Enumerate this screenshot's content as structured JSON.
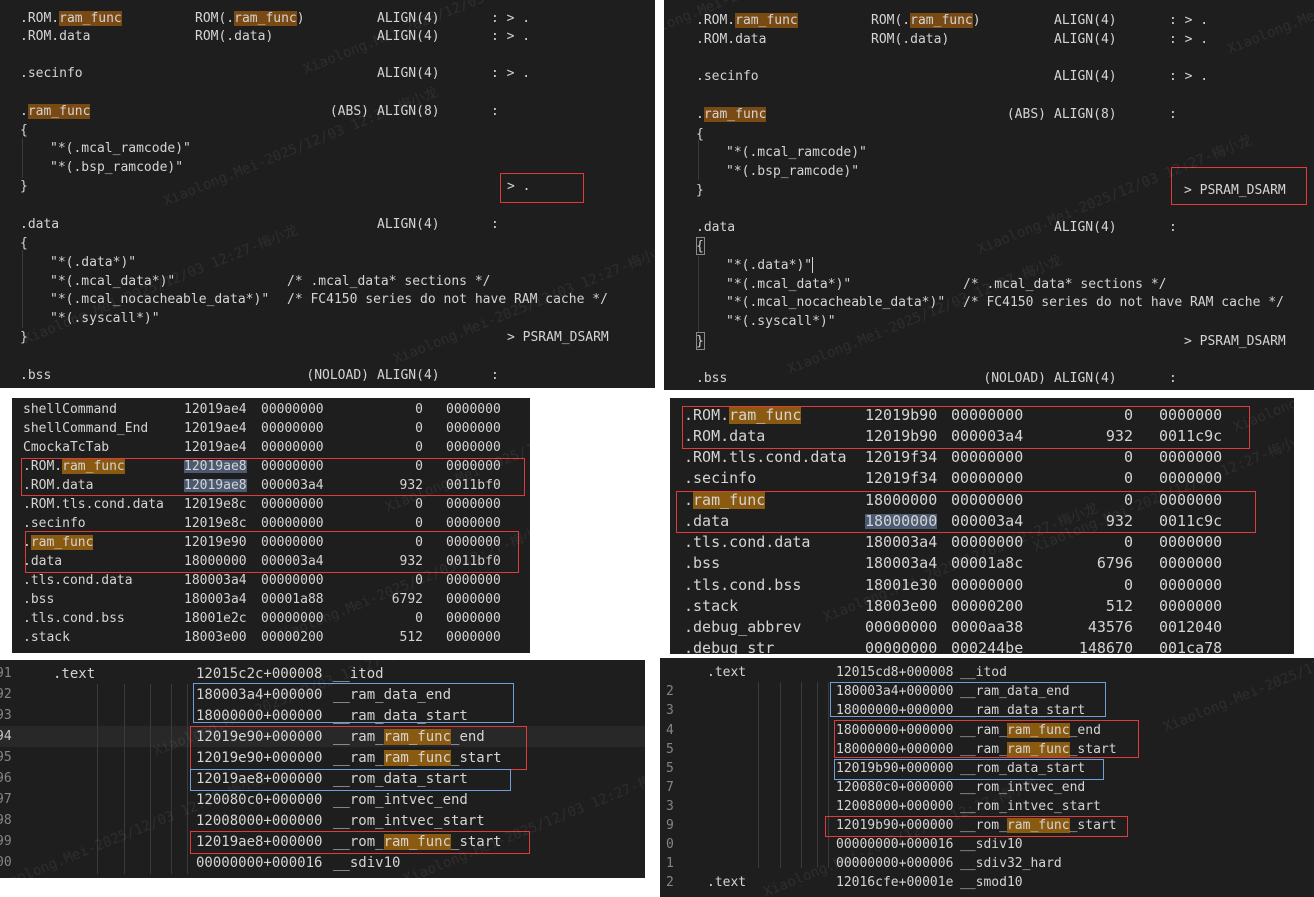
{
  "pane1": {
    "rows": [
      {
        "a_pre": ".ROM.",
        "a_hl": "ram_func",
        "b_pre": "ROM(.",
        "b_hl": "ram_func",
        "b_post": ")",
        "c": "ALIGN(4)",
        "d": ": > ."
      },
      {
        "a_pre": ".ROM.data",
        "b_pre": "ROM(.data)",
        "c": "ALIGN(4)",
        "d": ": > ."
      },
      {
        "a_pre": ".secinfo",
        "c": "ALIGN(4)",
        "d": ": > ."
      },
      {
        "a_pre": ".",
        "a_hl": "ram_func",
        "abs": "(ABS)",
        "c": "ALIGN(8)",
        "d": ":"
      },
      {
        "brace": "{"
      },
      {
        "ind": "\"*(.mcal_ramcode)\""
      },
      {
        "ind": "\"*(.bsp_ramcode)\""
      },
      {
        "brace": "}",
        "target": "> ."
      },
      {
        "a_pre": ".data",
        "c": "ALIGN(4)",
        "d": ":"
      },
      {
        "brace": "{"
      },
      {
        "ind": "\"*(.data*)\""
      },
      {
        "ind": "\"*(.mcal_data*)\"",
        "cmt": "/* .mcal_data* sections */"
      },
      {
        "ind": "\"*(.mcal_nocacheable_data*)\"",
        "cmt": "/* FC4150 series do not have RAM cache */"
      },
      {
        "ind": "\"*(.syscall*)\""
      },
      {
        "brace": "}",
        "target": "> PSRAM_DSARM"
      },
      {
        "a_pre": ".bss",
        "abs": "(NOLOAD)",
        "c": "ALIGN(4)",
        "d": ":"
      }
    ]
  },
  "pane2": {
    "rows": [
      {
        "a_pre": ".ROM.",
        "a_hl": "ram_func",
        "b_pre": "ROM(.",
        "b_hl": "ram_func",
        "b_post": ")",
        "c": "ALIGN(4)",
        "d": ": > ."
      },
      {
        "a_pre": ".ROM.data",
        "b_pre": "ROM(.data)",
        "c": "ALIGN(4)",
        "d": ": > ."
      },
      {
        "a_pre": ".secinfo",
        "c": "ALIGN(4)",
        "d": ": > ."
      },
      {
        "a_pre": ".",
        "a_hl": "ram_func",
        "abs": "(ABS)",
        "c": "ALIGN(8)",
        "d": ":"
      },
      {
        "brace": "{"
      },
      {
        "ind": "\"*(.mcal_ramcode)\""
      },
      {
        "ind": "\"*(.bsp_ramcode)\""
      },
      {
        "brace": "}",
        "target": "> PSRAM_DSARM"
      },
      {
        "a_pre": ".data",
        "c": "ALIGN(4)",
        "d": ":"
      },
      {
        "brace": "{"
      },
      {
        "ind": "\"*(.data*)\""
      },
      {
        "ind": "\"*(.mcal_data*)\"",
        "cmt": "/* .mcal_data* sections */"
      },
      {
        "ind": "\"*(.mcal_nocacheable_data*)\"",
        "cmt": "/* FC4150 series do not have RAM cache */"
      },
      {
        "ind": "\"*(.syscall*)\""
      },
      {
        "brace": "}",
        "target": "> PSRAM_DSARM"
      },
      {
        "a_pre": ".bss",
        "abs": "(NOLOAD)",
        "c": "ALIGN(4)",
        "d": ":"
      }
    ]
  },
  "pane3": {
    "rows": [
      {
        "name": "shellCommand",
        "addr": "12019ae4",
        "size": "00000000",
        "dec": "0",
        "off": "0000000"
      },
      {
        "name": "shellCommand_End",
        "addr": "12019ae4",
        "size": "00000000",
        "dec": "0",
        "off": "0000000"
      },
      {
        "name": "CmockaTcTab",
        "addr": "12019ae4",
        "size": "00000000",
        "dec": "0",
        "off": "0000000"
      },
      {
        "name_pre": ".ROM.",
        "name_hl": "ram_func",
        "addr": "12019ae8",
        "addr_sel": true,
        "size": "00000000",
        "dec": "0",
        "off": "0000000"
      },
      {
        "name": ".ROM.data",
        "addr": "12019ae8",
        "addr_sel": true,
        "size": "000003a4",
        "dec": "932",
        "off": "0011bf0"
      },
      {
        "name": ".ROM.tls.cond.data",
        "addr": "12019e8c",
        "size": "00000000",
        "dec": "0",
        "off": "0000000"
      },
      {
        "name": ".secinfo",
        "addr": "12019e8c",
        "size": "00000000",
        "dec": "0",
        "off": "0000000"
      },
      {
        "name_pre": ".",
        "name_hl": "ram_func",
        "addr": "12019e90",
        "size": "00000000",
        "dec": "0",
        "off": "0000000"
      },
      {
        "name": ".data",
        "addr": "18000000",
        "size": "000003a4",
        "dec": "932",
        "off": "0011bf0"
      },
      {
        "name": ".tls.cond.data",
        "addr": "180003a4",
        "size": "00000000",
        "dec": "0",
        "off": "0000000"
      },
      {
        "name": ".bss",
        "addr": "180003a4",
        "size": "00001a88",
        "dec": "6792",
        "off": "0000000"
      },
      {
        "name": ".tls.cond.bss",
        "addr": "18001e2c",
        "size": "00000000",
        "dec": "0",
        "off": "0000000"
      },
      {
        "name": ".stack",
        "addr": "18003e00",
        "size": "00000200",
        "dec": "512",
        "off": "0000000"
      }
    ]
  },
  "pane4": {
    "rows": [
      {
        "name_pre": ".ROM.",
        "name_hl": "ram_func",
        "addr": "12019b90",
        "size": "00000000",
        "dec": "0",
        "off": "0000000"
      },
      {
        "name": ".ROM.data",
        "addr": "12019b90",
        "size": "000003a4",
        "dec": "932",
        "off": "0011c9c"
      },
      {
        "name": ".ROM.tls.cond.data",
        "addr": "12019f34",
        "size": "00000000",
        "dec": "0",
        "off": "0000000"
      },
      {
        "name": ".secinfo",
        "addr": "12019f34",
        "size": "00000000",
        "dec": "0",
        "off": "0000000"
      },
      {
        "name_pre": ".",
        "name_hl": "ram_func",
        "addr": "18000000",
        "size": "00000000",
        "dec": "0",
        "off": "0000000"
      },
      {
        "name": ".data",
        "addr": "18000000",
        "addr_sel": true,
        "size": "000003a4",
        "dec": "932",
        "off": "0011c9c"
      },
      {
        "name": ".tls.cond.data",
        "addr": "180003a4",
        "size": "00000000",
        "dec": "0",
        "off": "0000000"
      },
      {
        "name": ".bss",
        "addr": "180003a4",
        "size": "00001a8c",
        "dec": "6796",
        "off": "0000000"
      },
      {
        "name": ".tls.cond.bss",
        "addr": "18001e30",
        "size": "00000000",
        "dec": "0",
        "off": "0000000"
      },
      {
        "name": ".stack",
        "addr": "18003e00",
        "size": "00000200",
        "dec": "512",
        "off": "0000000"
      },
      {
        "name": ".debug_abbrev",
        "addr": "00000000",
        "size": "0000aa38",
        "dec": "43576",
        "off": "0012040"
      },
      {
        "name": ".debug_str",
        "addr": "00000000",
        "size": "000244be",
        "dec": "148670",
        "off": "001ca78"
      }
    ]
  },
  "pane5": {
    "rows": [
      {
        "ln": "91",
        "sec": ".text",
        "val": "12015c2c+000008",
        "sym_pre": "__itod"
      },
      {
        "ln": "92",
        "val": "180003a4+000000",
        "sym_pre": "__ram_data_end"
      },
      {
        "ln": "93",
        "val": "18000000+000000",
        "sym_pre": "__ram_data_start"
      },
      {
        "ln": "94",
        "cur": true,
        "val": "12019e90+000000",
        "sym_pre": "__ram_",
        "sym_hl": "ram_func",
        "sym_post": "_end"
      },
      {
        "ln": "95",
        "val": "12019e90+000000",
        "sym_pre": "__ram_",
        "sym_hl": "ram_func",
        "sym_post": "_start"
      },
      {
        "ln": "96",
        "val": "12019ae8+000000",
        "sym_pre": "__rom_data_start"
      },
      {
        "ln": "97",
        "val": "120080c0+000000",
        "sym_pre": "__rom_intvec_end"
      },
      {
        "ln": "98",
        "val": "12008000+000000",
        "sym_pre": "__rom_intvec_start"
      },
      {
        "ln": "99",
        "val": "12019ae8+000000",
        "sym_pre": "__rom_",
        "sym_hl": "ram_func",
        "sym_post": "_start"
      },
      {
        "ln": "00",
        "val": "00000000+000016",
        "sym_pre": "__sdiv10"
      }
    ]
  },
  "pane6": {
    "rows": [
      {
        "ln": "",
        "sec": ".text",
        "val": "12015cd8+000008",
        "sym_pre": "__itod"
      },
      {
        "ln": "2",
        "val": "180003a4+000000",
        "sym_pre": "__ram_data_end"
      },
      {
        "ln": "3",
        "val": "18000000+000000",
        "sym_pre": "__ram_data_start"
      },
      {
        "ln": "4",
        "val": "18000000+000000",
        "sym_pre": "__ram_",
        "sym_hl": "ram_func",
        "sym_post": "_end"
      },
      {
        "ln": "5",
        "val": "18000000+000000",
        "sym_pre": "__ram_",
        "sym_hl": "ram_func",
        "sym_post": "_start"
      },
      {
        "ln": "5",
        "val": "12019b90+000000",
        "sym_pre": "__rom_data_start"
      },
      {
        "ln": "7",
        "val": "120080c0+000000",
        "sym_pre": "__rom_intvec_end"
      },
      {
        "ln": "3",
        "val": "12008000+000000",
        "sym_pre": "__rom_intvec_start"
      },
      {
        "ln": "9",
        "val": "12019b90+000000",
        "sym_pre": "__rom_",
        "sym_hl": "ram_func",
        "sym_post": "_start"
      },
      {
        "ln": "0",
        "val": "00000000+000016",
        "sym_pre": "__sdiv10"
      },
      {
        "ln": "1",
        "val": "00000000+000006",
        "sym_pre": "__sdiv32_hard"
      },
      {
        "ln": "2",
        "sec": ".text",
        "val": "12016cfe+00001e",
        "sym_pre": "__smod10"
      }
    ]
  },
  "watermark": "Xiaolong.Mei-2025/12/03 12:27-梅小龙"
}
